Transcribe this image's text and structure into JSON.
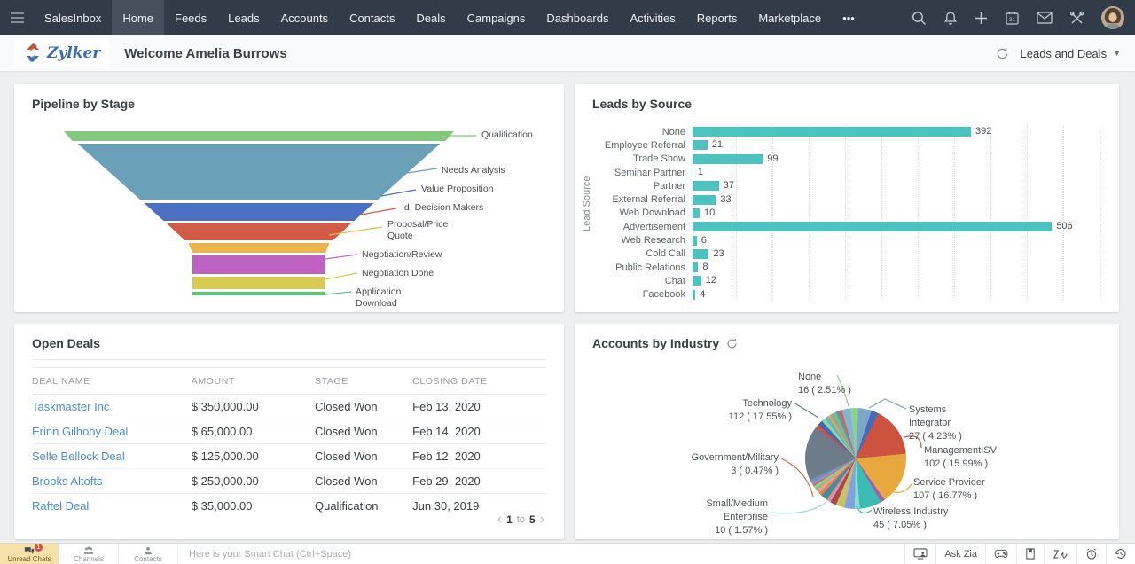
{
  "topnav": {
    "items": [
      {
        "label": "SalesInbox",
        "active": false
      },
      {
        "label": "Home",
        "active": true
      },
      {
        "label": "Feeds",
        "active": false
      },
      {
        "label": "Leads",
        "active": false
      },
      {
        "label": "Accounts",
        "active": false
      },
      {
        "label": "Contacts",
        "active": false
      },
      {
        "label": "Deals",
        "active": false
      },
      {
        "label": "Campaigns",
        "active": false
      },
      {
        "label": "Dashboards",
        "active": false
      },
      {
        "label": "Activities",
        "active": false
      },
      {
        "label": "Reports",
        "active": false
      },
      {
        "label": "Marketplace",
        "active": false
      },
      {
        "label": "•••",
        "active": false
      }
    ],
    "calendar_day": "31"
  },
  "header": {
    "brand": "Zylker",
    "welcome": "Welcome Amelia Burrows",
    "dashboard_selector": "Leads and Deals"
  },
  "chart_data": [
    {
      "panel": "pipeline-by-stage",
      "type": "funnel",
      "title": "Pipeline by Stage",
      "stages": [
        {
          "label": "Qualification",
          "color": "#84c87f"
        },
        {
          "label": "Needs Analysis",
          "color": "#6ba1b8"
        },
        {
          "label": "Value Proposition",
          "color": "#4b6fc2"
        },
        {
          "label": "Id. Decision Makers",
          "color": "#d25b45"
        },
        {
          "label": "Proposal/Price Quote",
          "color": "#edb44e",
          "wrap": [
            "Proposal/Price",
            "Quote"
          ]
        },
        {
          "label": "Negotiation/Review",
          "color": "#bf63c2"
        },
        {
          "label": "Negotiation Done",
          "color": "#d6ca55"
        },
        {
          "label": "Application Download",
          "color": "#57ca71",
          "wrap": [
            "Application",
            "Download"
          ],
          "truncated": true
        }
      ]
    },
    {
      "panel": "leads-by-source",
      "type": "bar",
      "orientation": "horizontal",
      "title": "Leads by Source",
      "ylabel": "Lead Source",
      "bar_color": "#4cc3bf",
      "xlim": [
        0,
        583
      ],
      "grid": "dotted-vertical",
      "categories": [
        "None",
        "Employee Referral",
        "Trade Show",
        "Seminar Partner",
        "Partner",
        "External Referral",
        "Web Download",
        "Advertisement",
        "Web Research",
        "Cold Call",
        "Public Relations",
        "Chat",
        "Facebook"
      ],
      "values": [
        392,
        21,
        99,
        1,
        37,
        33,
        10,
        506,
        6,
        23,
        8,
        12,
        4
      ],
      "last_row_clipped": true
    },
    {
      "panel": "open-deals",
      "type": "table",
      "title": "Open Deals",
      "columns": [
        "DEAL NAME",
        "AMOUNT",
        "STAGE",
        "CLOSING DATE"
      ],
      "rows": [
        {
          "name": "Taskmaster Inc",
          "amount": "$ 350,000.00",
          "stage": "Closed Won",
          "closing_date": "Feb 13, 2020"
        },
        {
          "name": "Erinn Gilhooy Deal",
          "amount": "$ 65,000.00",
          "stage": "Closed Won",
          "closing_date": "Feb 14, 2020"
        },
        {
          "name": "Selle Bellock Deal",
          "amount": "$ 125,000.00",
          "stage": "Closed Won",
          "closing_date": "Feb 12, 2020"
        },
        {
          "name": "Brooks Altofts",
          "amount": "$ 250,000.00",
          "stage": "Closed Won",
          "closing_date": "Feb 29, 2020"
        },
        {
          "name": "Raftel Deal",
          "amount": "$ 35,000.00",
          "stage": "Qualification",
          "closing_date": "Jun 30, 2019"
        }
      ],
      "pagination": {
        "prev": "‹",
        "start": "1",
        "to": "to",
        "end": "5",
        "next": "›"
      }
    },
    {
      "panel": "accounts-by-industry",
      "type": "pie",
      "title": "Accounts by Industry",
      "slices": [
        {
          "label": "None",
          "value": 16,
          "pct": "2.51%",
          "color": "#8ed08f"
        },
        {
          "label": "Systems Integrator",
          "value": 27,
          "pct": "4.23%",
          "color": "#7ba7cb",
          "wrap": [
            "Systems",
            "Integrator"
          ]
        },
        {
          "label": "ManagementISV",
          "value": 102,
          "pct": "15.99%",
          "color": "#cd5340"
        },
        {
          "label": "Service Provider",
          "value": 107,
          "pct": "16.77%",
          "color": "#e8a83e"
        },
        {
          "label": "Wireless Industry",
          "value": 45,
          "pct": "7.05%",
          "color": "#3cbdb4"
        },
        {
          "label": "Small/Medium Enterprise",
          "value": 10,
          "pct": "1.57%",
          "color": "#8fdcd6",
          "wrap": [
            "Small/Medium",
            "Enterprise"
          ]
        },
        {
          "label": "Government/Military",
          "value": 3,
          "pct": "0.47%",
          "color": "#d96a45"
        },
        {
          "label": "Technology",
          "value": 112,
          "pct": "17.55%",
          "color": "#6e7b8a"
        }
      ],
      "has_unlabeled_small_slices": true
    }
  ],
  "chatbar": {
    "tabs": [
      {
        "label": "Unread Chats",
        "badge": "1",
        "active": true
      },
      {
        "label": "Channels",
        "active": false
      },
      {
        "label": "Contacts",
        "active": false
      }
    ],
    "placeholder": "Here is your Smart Chat (Ctrl+Space)",
    "ask_zia": "Ask Zia"
  }
}
